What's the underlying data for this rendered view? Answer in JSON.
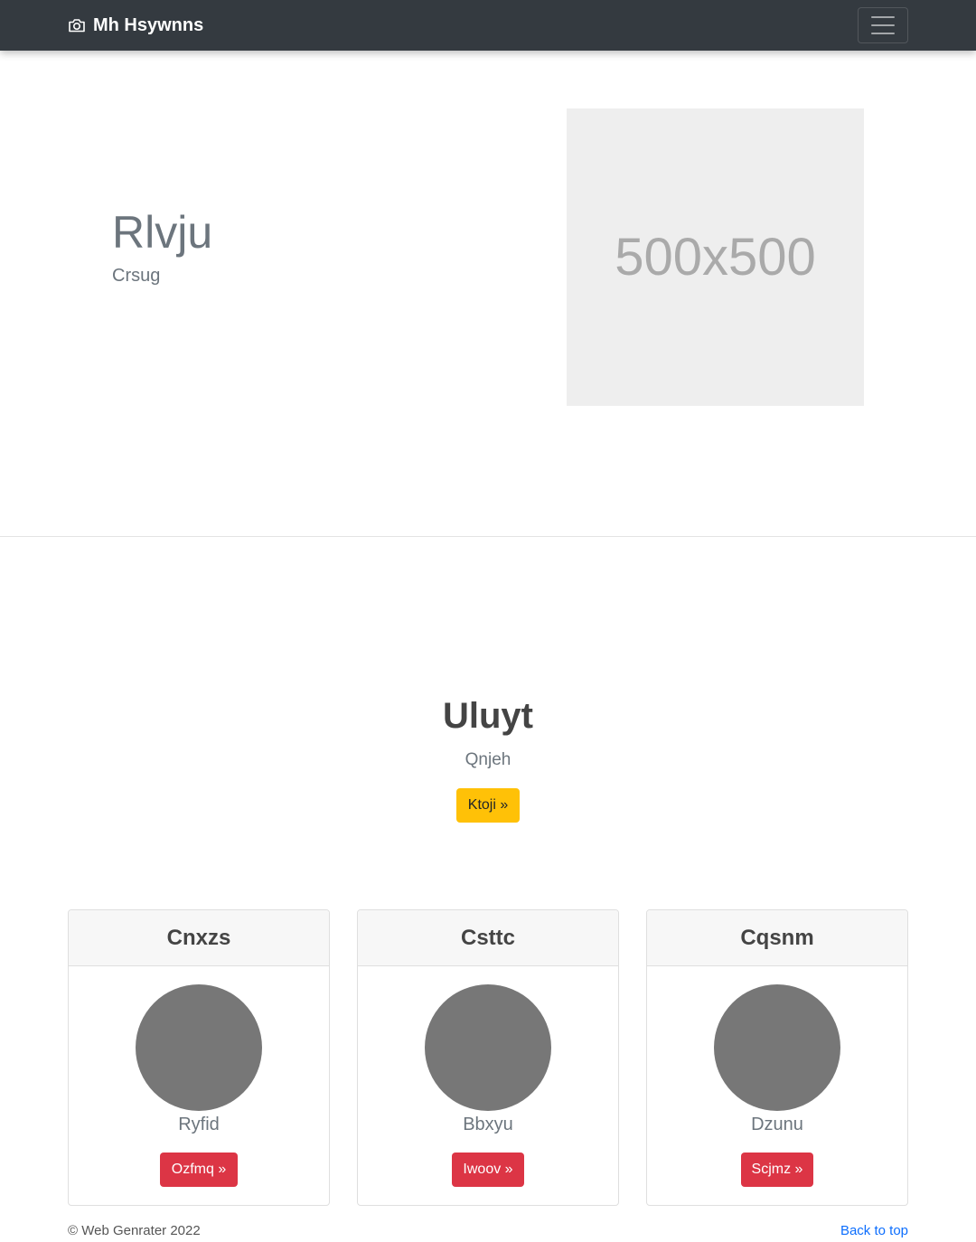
{
  "navbar": {
    "brand": "Mh Hsywnns",
    "brand_icon": "camera-icon",
    "toggle_icon": "hamburger-icon"
  },
  "hero": {
    "title": "Rlvju",
    "subtitle": "Crsug",
    "image_placeholder": "500x500"
  },
  "cta": {
    "title": "Uluyt",
    "subtitle": "Qnjeh",
    "button": "Ktoji »"
  },
  "cards": [
    {
      "header": "Cnxzs",
      "text": "Ryfid",
      "button": "Ozfmq »"
    },
    {
      "header": "Csttc",
      "text": "Bbxyu",
      "button": "Iwoov »"
    },
    {
      "header": "Cqsnm",
      "text": "Dzunu",
      "button": "Scjmz »"
    }
  ],
  "footer": {
    "copyright": "© Web Genrater 2022",
    "back_to_top": "Back to top"
  },
  "colors": {
    "navbar": "#343a40",
    "warning": "#ffc107",
    "danger": "#dc3545",
    "link": "#0d6efd",
    "avatar": "#777777"
  }
}
